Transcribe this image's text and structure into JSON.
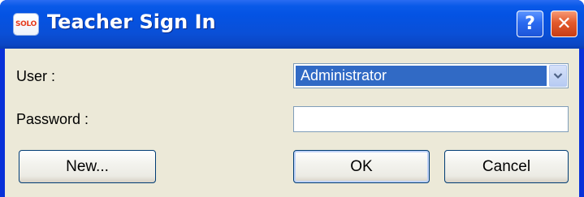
{
  "window": {
    "title": "Teacher Sign In",
    "app_icon_text": "SOLO",
    "help_glyph": "?",
    "close_glyph": "✕"
  },
  "form": {
    "user_label": "User :",
    "user_value": "Administrator",
    "password_label": "Password :",
    "password_value": ""
  },
  "buttons": {
    "new_label": "New...",
    "ok_label": "OK",
    "cancel_label": "Cancel"
  },
  "colors": {
    "titlebar": "#0453e4",
    "selection": "#316ac5",
    "client_bg": "#ece9d8"
  }
}
